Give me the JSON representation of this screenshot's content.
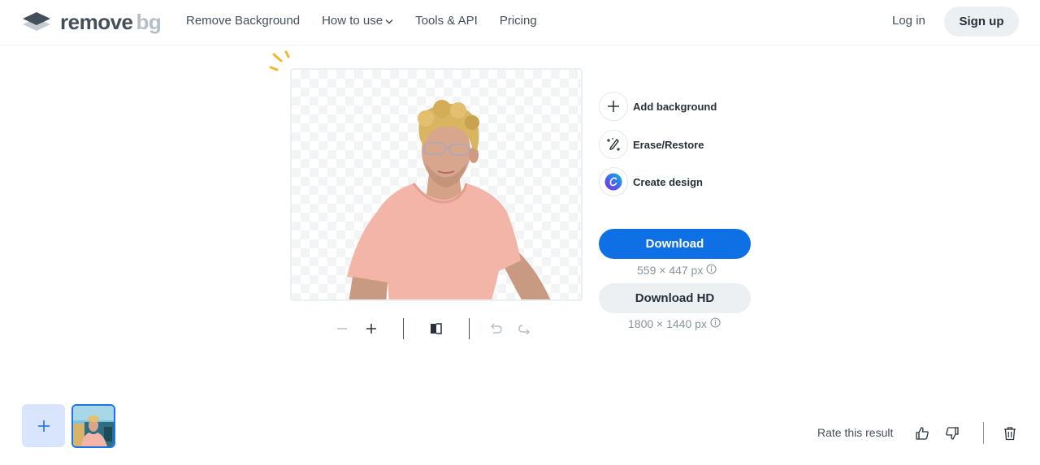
{
  "header": {
    "logo": {
      "word1": "remove",
      "word2": "bg",
      "icon": "layers-logo-icon"
    },
    "nav": [
      {
        "label": "Remove Background"
      },
      {
        "label": "How to use",
        "has_dropdown": true
      },
      {
        "label": "Tools & API"
      },
      {
        "label": "Pricing"
      }
    ],
    "login_label": "Log in",
    "signup_label": "Sign up"
  },
  "preview": {
    "description": "Man with curly blond hair, glasses and pink t-shirt, background removed (transparent checkerboard)"
  },
  "tools": {
    "zoom_out": "minus-icon",
    "zoom_in": "plus-icon",
    "compare": "compare-icon",
    "undo": "undo-icon",
    "redo": "redo-icon"
  },
  "actions": [
    {
      "label": "Add background",
      "icon": "plus-icon"
    },
    {
      "label": "Erase/Restore",
      "icon": "magic-brush-icon"
    },
    {
      "label": "Create design",
      "icon": "canva-logo-icon"
    }
  ],
  "download": {
    "label": "Download",
    "dimensions": "559 × 447 px"
  },
  "download_hd": {
    "label": "Download HD",
    "dimensions": "1800 × 1440 px"
  },
  "bottom": {
    "rate_label": "Rate this result",
    "icons": [
      "thumbs-up-icon",
      "thumbs-down-icon",
      "trash-icon"
    ]
  },
  "colors": {
    "accent": "#0f70e6",
    "text": "#454f5b",
    "muted": "#8a939c",
    "button_gray": "#ecf0f3",
    "sparkle": "#f5b731",
    "add_tile": "#d9e5fd"
  }
}
